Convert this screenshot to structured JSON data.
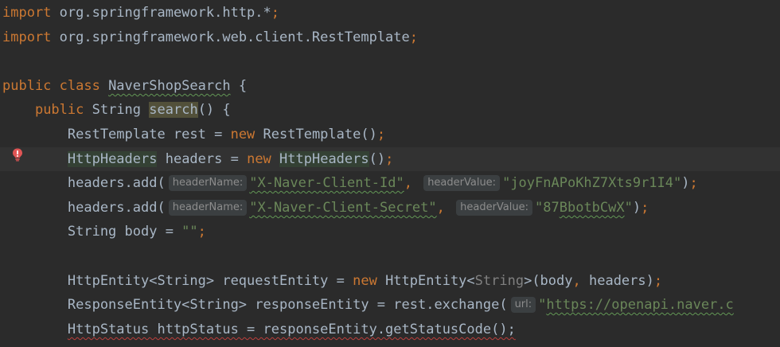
{
  "editor": {
    "lines": [
      [
        {
          "c": "kw",
          "t": "import "
        },
        {
          "c": "txt",
          "t": "org.springframework.http.*"
        },
        {
          "c": "kw",
          "t": ";"
        }
      ],
      [
        {
          "c": "kw",
          "t": "import "
        },
        {
          "c": "txt",
          "t": "org.springframework.web.client.RestTemplate"
        },
        {
          "c": "kw",
          "t": ";"
        }
      ],
      [],
      [
        {
          "c": "kw",
          "t": "public class "
        },
        {
          "c": "txt wavy-green",
          "t": "NaverShopSearch"
        },
        {
          "c": "txt",
          "t": " {"
        }
      ],
      [
        {
          "c": "txt",
          "t": "    "
        },
        {
          "c": "kw",
          "t": "public "
        },
        {
          "c": "txt",
          "t": "String "
        },
        {
          "c": "txt highlight-search",
          "t": "search"
        },
        {
          "c": "txt",
          "t": "() {"
        }
      ],
      [
        {
          "c": "txt",
          "t": "        RestTemplate rest = "
        },
        {
          "c": "kw",
          "t": "new "
        },
        {
          "c": "txt",
          "t": "RestTemplate()"
        },
        {
          "c": "kw",
          "t": ";"
        }
      ],
      [
        {
          "c": "txt",
          "t": "        "
        },
        {
          "c": "txt highlight-usage",
          "t": "HttpHeaders"
        },
        {
          "c": "txt",
          "t": " headers = "
        },
        {
          "c": "kw",
          "t": "new "
        },
        {
          "c": "txt highlight-usage",
          "t": "HttpHeaders"
        },
        {
          "c": "txt",
          "t": "()"
        },
        {
          "c": "kw",
          "t": ";"
        }
      ],
      [
        {
          "c": "txt",
          "t": "        headers.add("
        },
        {
          "c": "hint",
          "t": "headerName:"
        },
        {
          "c": "str wavy-green",
          "t": "\"X-Naver-Client-Id\""
        },
        {
          "c": "kw",
          "t": ", "
        },
        {
          "c": "hint",
          "t": "headerValue:"
        },
        {
          "c": "str",
          "t": "\"joyFnAPoKhZ7Xts9r1I4\""
        },
        {
          "c": "txt",
          "t": ")"
        },
        {
          "c": "kw",
          "t": ";"
        }
      ],
      [
        {
          "c": "txt",
          "t": "        headers.add("
        },
        {
          "c": "hint",
          "t": "headerName:"
        },
        {
          "c": "str wavy-green",
          "t": "\"X-Naver-Client-Secret\""
        },
        {
          "c": "kw",
          "t": ", "
        },
        {
          "c": "hint",
          "t": "headerValue:"
        },
        {
          "c": "str",
          "t": "\"87"
        },
        {
          "c": "str wavy-green",
          "t": "BbotbCwX"
        },
        {
          "c": "str",
          "t": "\""
        },
        {
          "c": "txt",
          "t": ")"
        },
        {
          "c": "kw",
          "t": ";"
        }
      ],
      [
        {
          "c": "txt",
          "t": "        String body = "
        },
        {
          "c": "str",
          "t": "\"\""
        },
        {
          "c": "kw",
          "t": ";"
        }
      ],
      [],
      [
        {
          "c": "txt",
          "t": "        HttpEntity<String> requestEntity = "
        },
        {
          "c": "kw",
          "t": "new "
        },
        {
          "c": "txt",
          "t": "HttpEntity<"
        },
        {
          "c": "dim",
          "t": "String"
        },
        {
          "c": "txt",
          "t": ">(body"
        },
        {
          "c": "kw",
          "t": ", "
        },
        {
          "c": "txt",
          "t": "headers)"
        },
        {
          "c": "kw",
          "t": ";"
        }
      ],
      [
        {
          "c": "txt",
          "t": "        ResponseEntity<String> responseEntity = rest.exchange("
        },
        {
          "c": "hint",
          "t": "url:"
        },
        {
          "c": "str",
          "t": "\""
        },
        {
          "c": "str wavy-green",
          "t": "https://openapi.naver.c"
        }
      ],
      [
        {
          "c": "txt",
          "t": "        "
        },
        {
          "c": "txt wavy-red",
          "t": "HttpStatus httpStatus = responseEntity.getStatusCode();"
        }
      ]
    ],
    "current_line": 6,
    "error_line": 6,
    "error_icon": "error-bulb-icon"
  }
}
